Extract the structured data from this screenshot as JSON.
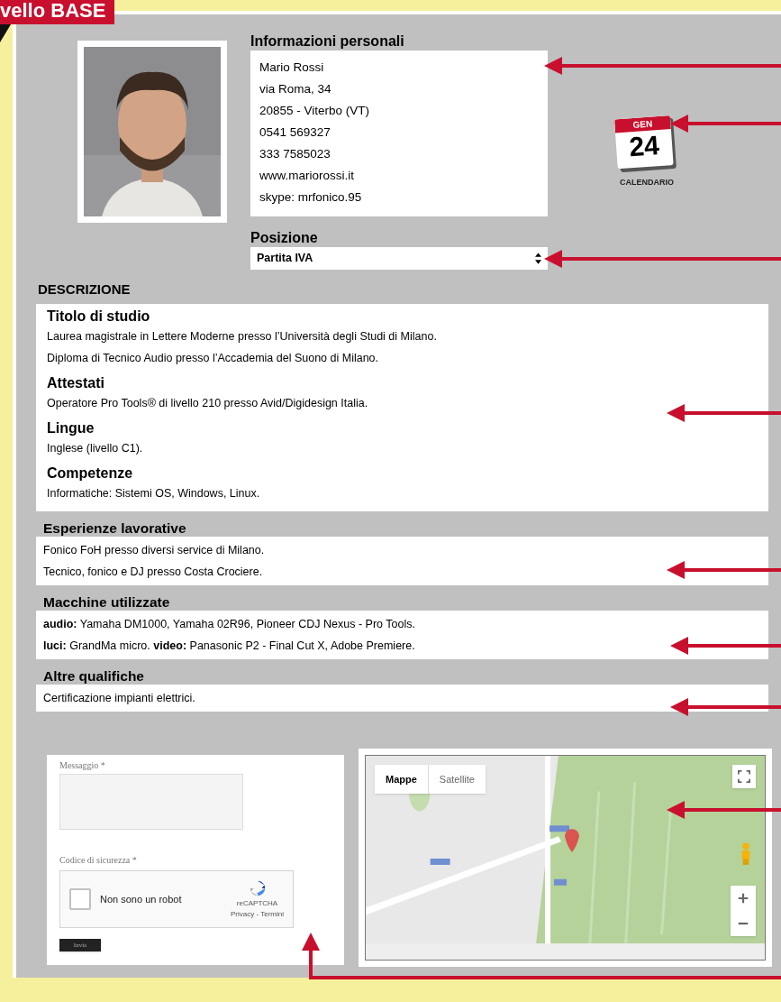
{
  "badge": "vello BASE",
  "personal_info": {
    "title": "Informazioni personali",
    "lines": [
      "Mario Rossi",
      "via Roma, 34",
      "20855 - Viterbo (VT)",
      "0541 569327",
      "333 7585023",
      "www.mariorossi.it",
      "skype: mrfonico.95"
    ]
  },
  "calendar": {
    "month": "GEN",
    "day": "24",
    "label": "CALENDARIO"
  },
  "position": {
    "title": "Posizione",
    "value": "Partita IVA"
  },
  "description": {
    "title": "DESCRIZIONE",
    "sections": [
      {
        "heading": "Titolo di studio",
        "lines": [
          "Laurea magistrale in Lettere Moderne presso l’Università degli Studi di Milano.",
          "Diploma di Tecnico Audio presso l’Accademia del Suono di Milano."
        ]
      },
      {
        "heading": "Attestati",
        "lines": [
          "Operatore Pro Tools® di livello 210 presso Avid/Digidesign Italia."
        ]
      },
      {
        "heading": "Lingue",
        "lines": [
          "Inglese (livello C1)."
        ]
      },
      {
        "heading": "Competenze",
        "lines": [
          "Informatiche: Sistemi OS, Windows, Linux."
        ]
      }
    ]
  },
  "blocks": [
    {
      "heading": "Esperienze lavorative",
      "lines": [
        "Fonico FoH presso diversi service di Milano.",
        "Tecnico, fonico e DJ presso Costa Crociere."
      ]
    },
    {
      "heading": "Macchine utilizzate",
      "lines": [
        "**audio:** Yamaha DM1000, Yamaha 02R96, Pioneer CDJ Nexus - Pro Tools.",
        "**luci:** GrandMa micro. **video:** Panasonic P2 - Final Cut X, Adobe Premiere."
      ]
    },
    {
      "heading": "Altre qualifiche",
      "lines": [
        "Certificazione impianti elettrici."
      ]
    }
  ],
  "contact_form": {
    "message_label": "Messaggio *",
    "captcha_label": "Codice di sicurezza *",
    "captcha_text": "Non sono un robot",
    "captcha_checked": false,
    "captcha_brand": "reCAPTCHA",
    "captcha_links": "Privacy - Termini",
    "submit": "Invia"
  },
  "map": {
    "tabs": [
      {
        "label": "Mappe",
        "selected": true
      },
      {
        "label": "Satellite",
        "selected": false
      }
    ]
  }
}
